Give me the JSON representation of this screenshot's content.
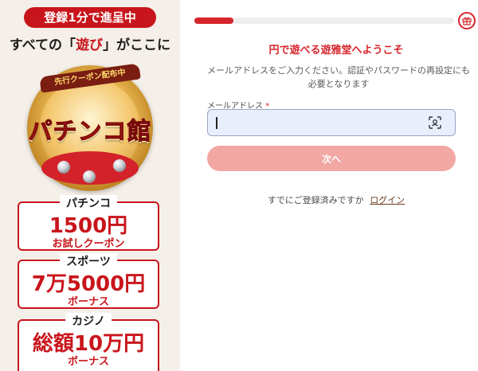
{
  "promo": {
    "ribbon": "登録1分で進呈中",
    "headline_pre": "すべての「",
    "headline_highlight": "遊び",
    "headline_post": "」がここに",
    "logo_band": "先行クーポン配布中",
    "logo_title": "パチンコ館",
    "cards": [
      {
        "category": "パチンコ",
        "amount": "1500円",
        "desc": "お試しクーポン"
      },
      {
        "category": "スポーツ",
        "amount": "7万5000円",
        "desc": "ボーナス"
      },
      {
        "category": "カジノ",
        "amount": "総額10万円",
        "desc": "ボーナス"
      }
    ],
    "colors": {
      "accent": "#c8151b",
      "background": "#f4efe8"
    }
  },
  "signup": {
    "progress": 0.15,
    "gift_icon": "gift-icon",
    "welcome": "円で遊べる遊雅堂へようこそ",
    "instruction": "メールアドレスをご入力ください。認証やパスワードの再設定にも必要となります",
    "email_label": "メールアドレス",
    "email_required_mark": "*",
    "email_value": "",
    "scan_icon": "face-scan-icon",
    "next_label": "次へ",
    "already_text": "すでにご登録済みですか",
    "login_label": "ログイン",
    "colors": {
      "accent": "#d6262c",
      "button_disabled": "#f2a7a3",
      "input_bg": "#e8eefb"
    }
  }
}
